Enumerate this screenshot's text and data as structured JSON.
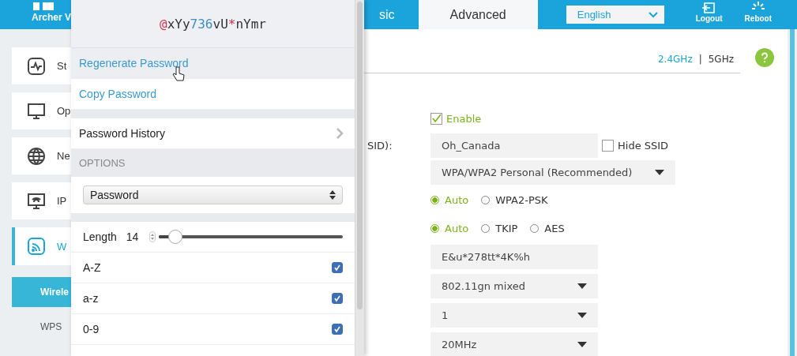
{
  "header": {
    "logo_text": "Archer V",
    "tabs": [
      {
        "label": "sic",
        "selected": false
      },
      {
        "label": "Advanced",
        "selected": true
      }
    ],
    "language": "English",
    "actions": [
      {
        "label": "Logout",
        "kind": "logout"
      },
      {
        "label": "Reboot",
        "kind": "reboot"
      }
    ]
  },
  "sidebar": {
    "items": [
      {
        "label": "St",
        "kind": "status",
        "selected": false
      },
      {
        "label": "Op",
        "kind": "operation",
        "selected": false
      },
      {
        "label": "Ne",
        "kind": "network",
        "selected": false
      },
      {
        "label": "IP",
        "kind": "iptv",
        "selected": false
      },
      {
        "label": "W",
        "kind": "wireless",
        "selected": true
      }
    ],
    "subitems": [
      {
        "label": "Wirele",
        "selected": true
      },
      {
        "label": "WPS",
        "selected": false
      }
    ]
  },
  "main": {
    "bands": [
      {
        "label": "2.4GHz",
        "selected": true
      },
      {
        "label": "5GHz",
        "selected": false
      }
    ],
    "band_separator": "|",
    "enable": {
      "label": "Enable",
      "checked": true
    },
    "ssid_label": "SID):",
    "ssid": "Oh_Canada",
    "hide_ssid": {
      "label": "Hide SSID",
      "checked": false
    },
    "security": "WPA/WPA2 Personal (Recommended)",
    "version_options": [
      {
        "label": "Auto",
        "selected": true
      },
      {
        "label": "WPA2-PSK",
        "selected": false
      }
    ],
    "encryption_options": [
      {
        "label": "Auto",
        "selected": true
      },
      {
        "label": "TKIP",
        "selected": false
      },
      {
        "label": "AES",
        "selected": false
      }
    ],
    "password": "E&u*278tt*4K%h",
    "mode": "802.11gn mixed",
    "channel": "1",
    "channel_width": "20MHz"
  },
  "popup": {
    "password": [
      {
        "text": "@",
        "kind": "symbol"
      },
      {
        "text": "xYy",
        "kind": "letter"
      },
      {
        "text": "736",
        "kind": "digit"
      },
      {
        "text": "vU",
        "kind": "letter"
      },
      {
        "text": "*",
        "kind": "symbol"
      },
      {
        "text": "nYmr",
        "kind": "letter"
      }
    ],
    "actions": [
      {
        "label": "Regenerate Password",
        "hovered": true
      },
      {
        "label": "Copy Password",
        "hovered": false
      }
    ],
    "history": "Password History",
    "options_heading": "OPTIONS",
    "type": "Password",
    "length": {
      "label": "Length",
      "value": "14",
      "level": 0.09
    },
    "charsets": [
      {
        "label": "A-Z",
        "checked": true
      },
      {
        "label": "a-z",
        "checked": true
      },
      {
        "label": "0-9",
        "checked": true
      }
    ]
  }
}
